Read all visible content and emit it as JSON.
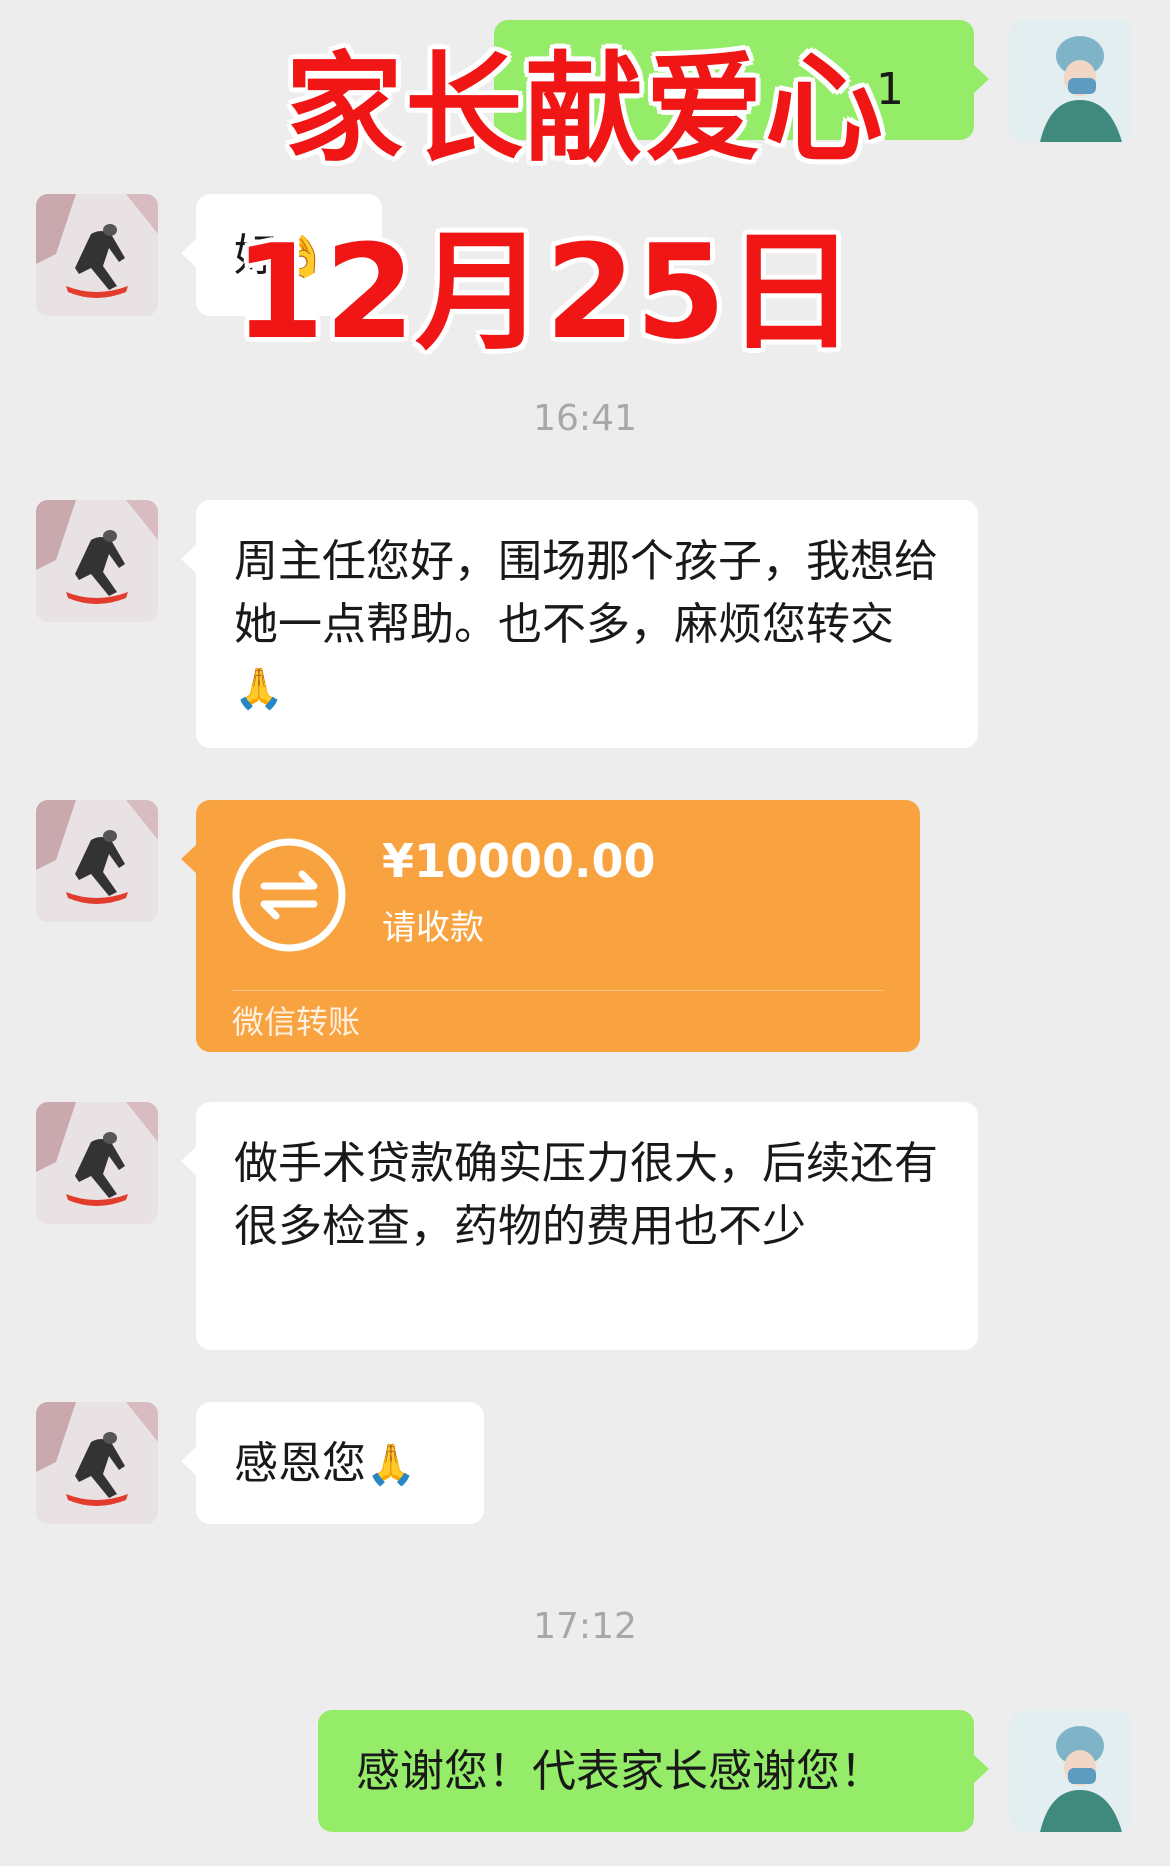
{
  "overlay": {
    "title": "家长献爱心",
    "date": "12月25日"
  },
  "top_message": {
    "partial_text": "1"
  },
  "messages": [
    {
      "text": "好",
      "emoji": "👌"
    },
    {
      "text": "周主任您好，围场那个孩子，我想给她一点帮助。也不多，麻烦您转交",
      "emoji": "🙏"
    },
    {
      "text": "做手术贷款确实压力很大，后续还有很多检查，药物的费用也不少"
    },
    {
      "text": "感恩您",
      "emoji": "🙏"
    }
  ],
  "timestamps": {
    "first": "16:41",
    "second": "17:12"
  },
  "transfer": {
    "amount": "¥10000.00",
    "status": "请收款",
    "footer": "微信转账",
    "icon": "transfer-arrows-icon"
  },
  "reply": {
    "text": "感谢您！代表家长感谢您！"
  },
  "colors": {
    "background": "#ededed",
    "green_bubble": "#95ec69",
    "transfer_orange": "#f8a340",
    "overlay_red": "#f01616"
  }
}
